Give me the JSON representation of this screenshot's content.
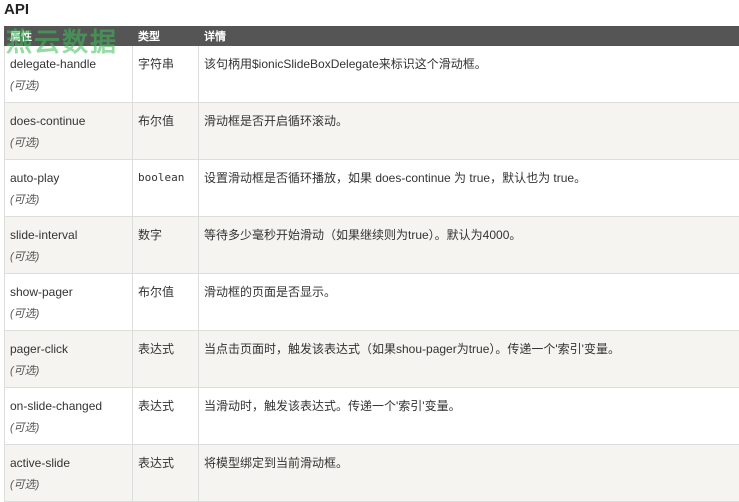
{
  "page": {
    "heading": "API"
  },
  "table": {
    "headers": [
      "属性",
      "类型",
      "详情"
    ],
    "rows": [
      {
        "attr": "delegate-handle",
        "optional": "(可选)",
        "type": "字符串",
        "detail": "该句柄用$ionicSlideBoxDelegate来标识这个滑动框。"
      },
      {
        "attr": "does-continue",
        "optional": "(可选)",
        "type": "布尔值",
        "detail": "滑动框是否开启循环滚动。"
      },
      {
        "attr": "auto-play",
        "optional": "(可选)",
        "type": "boolean",
        "detail": "设置滑动框是否循环播放，如果 does-continue 为 true，默认也为 true。"
      },
      {
        "attr": "slide-interval",
        "optional": "(可选)",
        "type": "数字",
        "detail": "等待多少毫秒开始滑动（如果继续则为true）。默认为4000。"
      },
      {
        "attr": "show-pager",
        "optional": "(可选)",
        "type": "布尔值",
        "detail": "滑动框的页面是否显示。"
      },
      {
        "attr": "pager-click",
        "optional": "(可选)",
        "type": "表达式",
        "detail": "当点击页面时，触发该表达式（如果shou-pager为true）。传递一个'索引'变量。"
      },
      {
        "attr": "on-slide-changed",
        "optional": "(可选)",
        "type": "表达式",
        "detail": "当滑动时，触发该表达式。传递一个'索引'变量。"
      },
      {
        "attr": "active-slide",
        "optional": "(可选)",
        "type": "表达式",
        "detail": "将模型绑定到当前滑动框。"
      }
    ]
  },
  "watermark": {
    "text": "燕云数据"
  },
  "colors": {
    "header_bg": "#555555",
    "header_text": "#ffffff",
    "row_alt": "#f6f4f0",
    "border": "#dddddd"
  }
}
